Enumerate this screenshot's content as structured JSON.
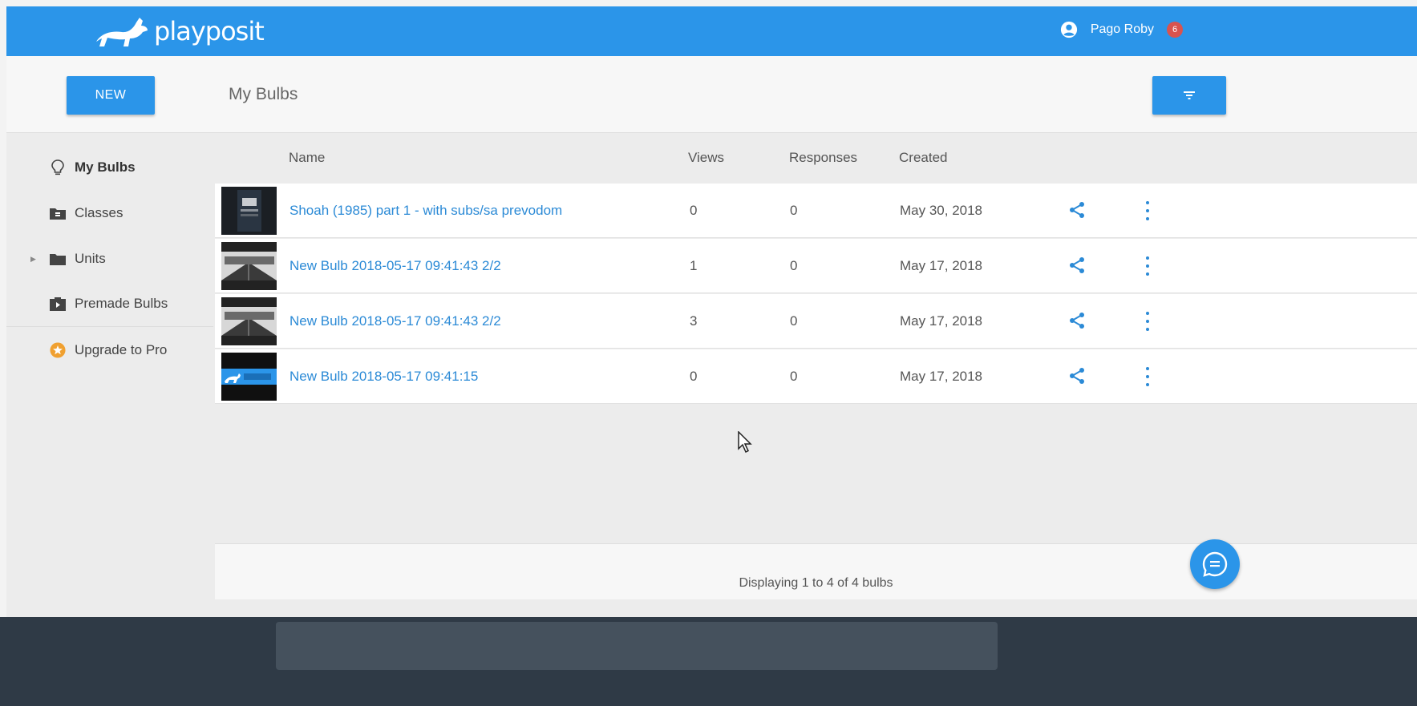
{
  "header": {
    "logo_text": "playposit",
    "user_name": "Pago Roby",
    "notification_count": "6"
  },
  "toolbar": {
    "new_label": "NEW",
    "page_title": "My Bulbs",
    "filter_icon": "filter-icon"
  },
  "sidebar": {
    "items": [
      {
        "label": "My Bulbs",
        "icon": "lightbulb-icon",
        "active": true
      },
      {
        "label": "Classes",
        "icon": "class-folder-icon"
      },
      {
        "label": "Units",
        "icon": "folder-icon",
        "expandable": true
      },
      {
        "label": "Premade Bulbs",
        "icon": "premade-bag-icon"
      },
      {
        "label": "Upgrade to Pro",
        "icon": "star-badge-icon"
      }
    ]
  },
  "table": {
    "columns": {
      "name": "Name",
      "views": "Views",
      "responses": "Responses",
      "created": "Created"
    },
    "rows": [
      {
        "name": "Shoah (1985) part 1 - with subs/sa prevodom",
        "views": "0",
        "responses": "0",
        "created": "May 30, 2018"
      },
      {
        "name": "New Bulb 2018-05-17 09:41:43 2/2",
        "views": "1",
        "responses": "0",
        "created": "May 17, 2018"
      },
      {
        "name": "New Bulb 2018-05-17 09:41:43 2/2",
        "views": "3",
        "responses": "0",
        "created": "May 17, 2018"
      },
      {
        "name": "New Bulb 2018-05-17 09:41:15",
        "views": "0",
        "responses": "0",
        "created": "May 17, 2018"
      }
    ]
  },
  "footer": {
    "status": "Displaying 1 to 4 of 4 bulbs"
  },
  "colors": {
    "accent": "#2b95e9",
    "link": "#2b8ad6",
    "badge": "#d9534f"
  }
}
